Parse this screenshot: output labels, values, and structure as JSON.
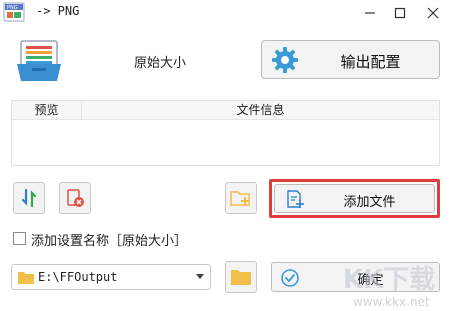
{
  "window": {
    "title": "-> PNG",
    "icon": "format-factory-png-icon",
    "controls": [
      "minimize-icon",
      "maximize-icon",
      "close-icon"
    ]
  },
  "header": {
    "profile_name": "原始大小",
    "output_config_label": "输出配置",
    "icons": [
      "profile-card-icon",
      "gear-icon"
    ]
  },
  "file_table": {
    "columns": [
      "预览",
      "文件信息"
    ],
    "rows": []
  },
  "toolbar": {
    "add_file_label": "添加文件",
    "icons": [
      "sort-icon",
      "clear-list-icon",
      "add-folder-icon",
      "add-file-icon"
    ]
  },
  "options": {
    "add_setting_name_label": "添加设置名称［原始大小］",
    "add_setting_name_checked": false
  },
  "output": {
    "path": "E:\\FFOutput",
    "ok_label": "确定",
    "icons": [
      "folder-icon",
      "browse-folder-icon",
      "check-circle-icon"
    ]
  },
  "watermark": {
    "text": "KK下载",
    "url": "www.kkx.net"
  },
  "colors": {
    "highlight_border": "#e23b3b",
    "gear_blue": "#3a9bd8",
    "folder_yellow": "#f2c04a",
    "sort_blue": "#2f7fcf",
    "sort_green": "#2fa84f",
    "clear_red": "#e0534a"
  }
}
